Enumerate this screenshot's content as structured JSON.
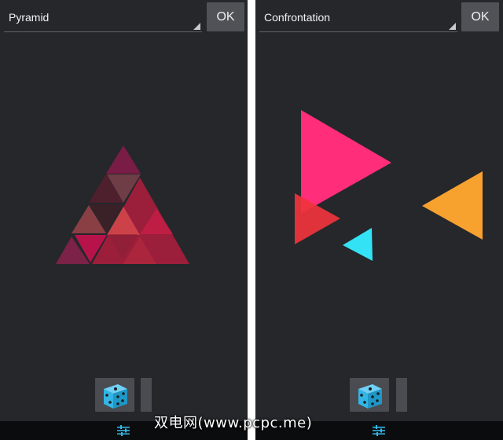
{
  "panels": [
    {
      "dropdown": {
        "selected": "Pyramid"
      },
      "ok_label": "OK",
      "icons": {
        "randomize": "dice-icon",
        "settings": "tune-icon"
      }
    },
    {
      "dropdown": {
        "selected": "Confrontation"
      },
      "ok_label": "OK",
      "icons": {
        "randomize": "dice-icon",
        "settings": "tune-icon"
      }
    }
  ],
  "colors": {
    "background": "#25272b",
    "button": "#505257",
    "accent_icon": "#33b5e5",
    "pink": "#ff2d7a",
    "red": "#f0333c",
    "cyan": "#33e3f5",
    "orange": "#f7a12f",
    "pyramid_crimson": "#a3203c",
    "pyramid_wine": "#6b1b34"
  },
  "watermark": "双电网(www.pcpc.me)"
}
